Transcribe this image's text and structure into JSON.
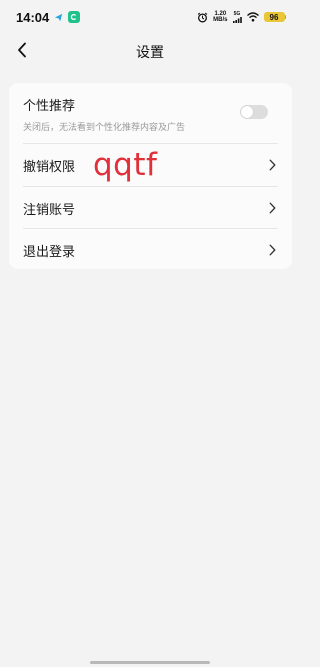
{
  "statusbar": {
    "time": "14:04",
    "speed_value": "1.20",
    "speed_unit": "MB/s",
    "network": "5G",
    "battery": "96",
    "icons": [
      "telegram-like-icon",
      "app-c-icon",
      "alarm-icon",
      "signal-icon",
      "wifi-icon",
      "battery-icon"
    ]
  },
  "header": {
    "title": "设置",
    "back_icon": "back-arrow-icon"
  },
  "settings": {
    "personalized": {
      "title": "个性推荐",
      "subtitle": "关闭后，无法看到个性化推荐内容及广告",
      "enabled": false
    },
    "items": [
      {
        "label": "撤销权限",
        "icon": "chevron-right-icon"
      },
      {
        "label": "注销账号",
        "icon": "chevron-right-icon"
      },
      {
        "label": "退出登录",
        "icon": "chevron-right-icon"
      }
    ]
  },
  "watermark": "qqtf",
  "colors": {
    "background": "#f2f3f2",
    "card": "#fbfbfb",
    "watermark": "#e0303a",
    "battery": "#e8c638",
    "app_icon": "#1fc28b"
  }
}
